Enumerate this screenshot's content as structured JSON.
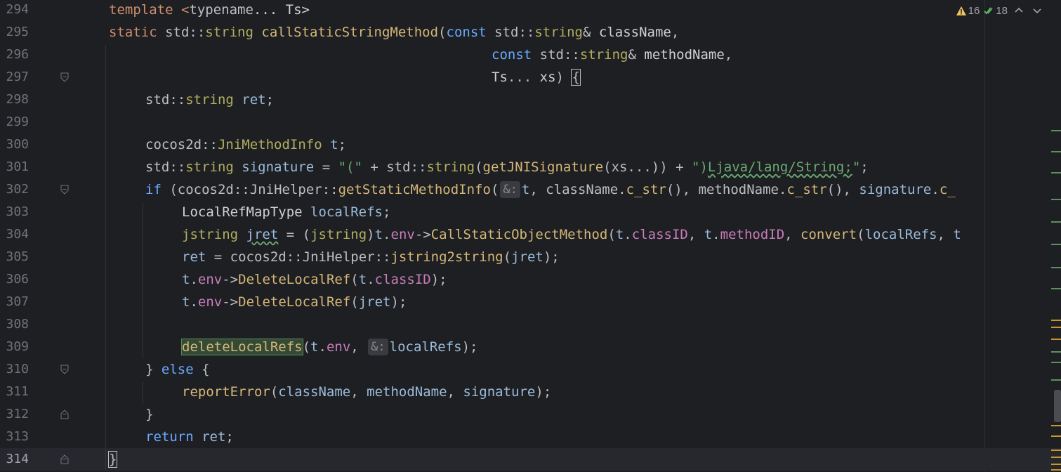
{
  "editor": {
    "inspections": {
      "warnings": "16",
      "ok": "18"
    },
    "lines": [
      {
        "n": "294",
        "indent": 0
      },
      {
        "n": "295",
        "indent": 0
      },
      {
        "n": "296",
        "indent": 0
      },
      {
        "n": "297",
        "indent": 0
      },
      {
        "n": "298",
        "indent": 1
      },
      {
        "n": "299",
        "indent": 0
      },
      {
        "n": "300",
        "indent": 1
      },
      {
        "n": "301",
        "indent": 1
      },
      {
        "n": "302",
        "indent": 1
      },
      {
        "n": "303",
        "indent": 2
      },
      {
        "n": "304",
        "indent": 2
      },
      {
        "n": "305",
        "indent": 2
      },
      {
        "n": "306",
        "indent": 2
      },
      {
        "n": "307",
        "indent": 2
      },
      {
        "n": "308",
        "indent": 0
      },
      {
        "n": "309",
        "indent": 2
      },
      {
        "n": "310",
        "indent": 1
      },
      {
        "n": "311",
        "indent": 2
      },
      {
        "n": "312",
        "indent": 1
      },
      {
        "n": "313",
        "indent": 1
      },
      {
        "n": "314",
        "indent": 0
      }
    ],
    "tokens": {
      "l294": [
        "template <",
        "typename",
        "... Ts>"
      ],
      "l295": [
        "static ",
        "std",
        "::",
        "string ",
        "callStaticStringMethod",
        "(",
        "const ",
        "std",
        "::",
        "string",
        "& ",
        "className",
        ","
      ],
      "l296": [
        "const ",
        "std",
        "::",
        "string",
        "& ",
        "methodName",
        ","
      ],
      "l297": [
        "Ts",
        "... ",
        "xs",
        ") ",
        "{"
      ],
      "l298": [
        "std",
        "::",
        "string ",
        "ret",
        ";"
      ],
      "l300": [
        "cocos2d",
        "::",
        "JniMethodInfo ",
        "t",
        ";"
      ],
      "l301": [
        "std",
        "::",
        "string ",
        "signature",
        " = ",
        "\"(\"",
        " + ",
        "std",
        "::",
        "string",
        "(",
        "getJNISignature",
        "(",
        "xs",
        "...)) ",
        "+ ",
        "\")",
        "Ljava/lang/String;",
        "\"",
        ";"
      ],
      "l302": [
        "if ",
        "(",
        "cocos2d",
        "::",
        "JniHelper",
        "::",
        "getStaticMethodInfo",
        "(",
        "&:",
        "t",
        ", ",
        "className",
        ".",
        "c_str",
        "(), ",
        "methodName",
        ".",
        "c_str",
        "(), ",
        "signature",
        ".",
        "c_"
      ],
      "l303": [
        "LocalRefMapType ",
        "localRefs",
        ";"
      ],
      "l304": [
        "jstring ",
        "jret",
        " = ",
        "(",
        "jstring",
        ")",
        "t",
        ".",
        "env",
        "->",
        "CallStaticObjectMethod",
        "(",
        "t",
        ".",
        "classID",
        ", ",
        "t",
        ".",
        "methodID",
        ", ",
        "convert",
        "(",
        "localRefs",
        ", ",
        "t"
      ],
      "l305": [
        "ret",
        " = ",
        "cocos2d",
        "::",
        "JniHelper",
        "::",
        "jstring2string",
        "(",
        "jret",
        ");"
      ],
      "l306": [
        "t",
        ".",
        "env",
        "->",
        "DeleteLocalRef",
        "(",
        "t",
        ".",
        "classID",
        ");"
      ],
      "l307": [
        "t",
        ".",
        "env",
        "->",
        "DeleteLocalRef",
        "(",
        "jret",
        ");"
      ],
      "l309": [
        "deleteLocalRefs",
        "(",
        "t",
        ".",
        "env",
        ", ",
        "&:",
        "localRefs",
        ");"
      ],
      "l310": [
        "} ",
        "else ",
        "{"
      ],
      "l311": [
        "reportError",
        "(",
        "className",
        ", ",
        "methodName",
        ", ",
        "signature",
        ");"
      ],
      "l312": [
        "}"
      ],
      "l313": [
        "return ",
        "ret",
        ";"
      ],
      "l314": [
        "}"
      ]
    }
  },
  "colors": {
    "background": "#1e1f22",
    "current_line": "#26282e",
    "keyword": "#cf8e6d",
    "function": "#56a8f5",
    "string": "#6aab73",
    "field": "#c77dbb"
  },
  "icons": [
    "warning-icon",
    "double-check-icon",
    "chevron-up-icon",
    "fold-marker-icon"
  ]
}
